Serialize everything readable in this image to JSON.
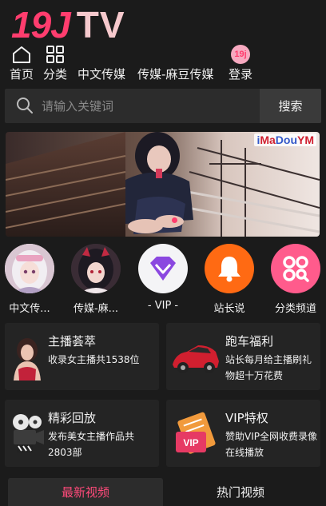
{
  "logo": {
    "part1": "19J",
    "part2": "TV"
  },
  "nav": {
    "items": [
      {
        "label": "首页",
        "icon": "home-icon"
      },
      {
        "label": "分类",
        "icon": "grid-icon"
      },
      {
        "label": "中文传媒"
      },
      {
        "label": "传媒-麻豆传媒"
      },
      {
        "label": "登录",
        "icon": "login-badge-icon",
        "badge": "19j"
      }
    ]
  },
  "search": {
    "placeholder": "请输入关键词",
    "button": "搜索"
  },
  "banner": {
    "brand_a": "Ma",
    "brand_b": "Dou",
    "brand_c": "YM"
  },
  "channels": [
    {
      "label": "中文传...",
      "icon": "anime-avatar-pink"
    },
    {
      "label": "传媒-麻...",
      "icon": "anime-avatar-dark"
    },
    {
      "label": "- VIP -",
      "icon": "vip-gem-icon"
    },
    {
      "label": "站长说",
      "icon": "bell-icon"
    },
    {
      "label": "分类频道",
      "icon": "category-icon"
    }
  ],
  "cards": [
    {
      "title": "主播荟萃",
      "desc": "收录女主播共1538位",
      "icon": "hostess-photo"
    },
    {
      "title": "跑车福利",
      "desc": "站长每月给主播刷礼物超十万花费",
      "icon": "sports-car-icon"
    },
    {
      "title": "精彩回放",
      "desc": "发布美女主播作品共2803部",
      "icon": "film-camera-icon"
    },
    {
      "title": "VIP特权",
      "desc": "赞助VIP全网收费录像在线播放",
      "icon": "vip-ticket-icon"
    }
  ],
  "tabs": {
    "latest": "最新视频",
    "hot": "热门视频"
  },
  "colors": {
    "accent": "#ff3d6e",
    "background": "#1b1b1b",
    "card": "#242424"
  }
}
